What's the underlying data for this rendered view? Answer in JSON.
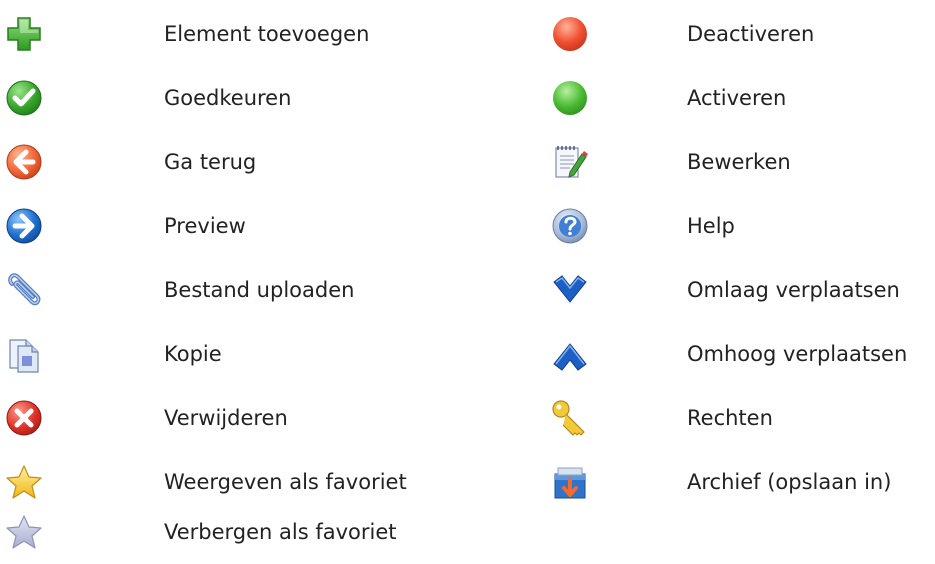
{
  "legend": {
    "left": [
      {
        "icon": "add-plus-icon",
        "label": "Element toevoegen"
      },
      {
        "icon": "approve-check-icon",
        "label": "Goedkeuren"
      },
      {
        "icon": "back-arrow-icon",
        "label": "Ga terug"
      },
      {
        "icon": "preview-arrow-icon",
        "label": "Preview"
      },
      {
        "icon": "paperclip-icon",
        "label": "Bestand uploaden"
      },
      {
        "icon": "copy-icon",
        "label": "Kopie"
      },
      {
        "icon": "delete-x-icon",
        "label": "Verwijderen"
      },
      {
        "icon": "star-gold-icon",
        "label": "Weergeven als favoriet"
      },
      {
        "icon": "star-grey-icon",
        "label": "Verbergen als favoriet"
      }
    ],
    "right": [
      {
        "icon": "red-dot-icon",
        "label": "Deactiveren"
      },
      {
        "icon": "green-dot-icon",
        "label": "Activeren"
      },
      {
        "icon": "edit-notepad-icon",
        "label": "Bewerken"
      },
      {
        "icon": "help-question-icon",
        "label": "Help"
      },
      {
        "icon": "chevron-down-icon",
        "label": "Omlaag verplaatsen"
      },
      {
        "icon": "chevron-up-icon",
        "label": "Omhoog verplaatsen"
      },
      {
        "icon": "key-icon",
        "label": "Rechten"
      },
      {
        "icon": "archive-box-icon",
        "label": "Archief (opslaan in)"
      }
    ]
  },
  "colors": {
    "text": "#222222",
    "green": "#3aa62e",
    "red": "#e0442a",
    "orange": "#f0663a",
    "blue": "#1e6fd0",
    "gold": "#f3c21b",
    "grey_star": "#aeb4cf"
  }
}
